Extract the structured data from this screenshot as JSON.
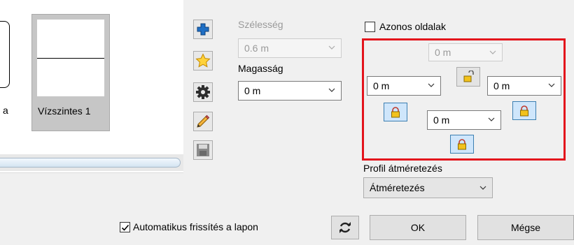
{
  "thumbnails": {
    "prev_label": "a",
    "current_label": "Vízszintes 1"
  },
  "toolbar": {
    "icons": [
      "add-icon",
      "star-icon",
      "gear-icon",
      "pencil-icon",
      "save-icon"
    ]
  },
  "width": {
    "label": "Szélesség",
    "value": "0.6 m"
  },
  "height": {
    "label": "Magasság",
    "value": "0 m"
  },
  "sides": {
    "same_sides_label": "Azonos oldalak",
    "same_sides_checked": false,
    "top_value": "0 m",
    "left_value": "0 m",
    "right_value": "0 m",
    "bottom_value": "0 m"
  },
  "profile": {
    "label": "Profil átméretezés",
    "value": "Átméretezés"
  },
  "footer": {
    "auto_refresh_label": "Automatikus frissítés a lapon",
    "auto_refresh_checked": true,
    "ok_label": "OK",
    "cancel_label": "Mégse"
  },
  "colors": {
    "highlight_frame": "#e3141c",
    "lock_button_fill": "#cfe6fb"
  }
}
